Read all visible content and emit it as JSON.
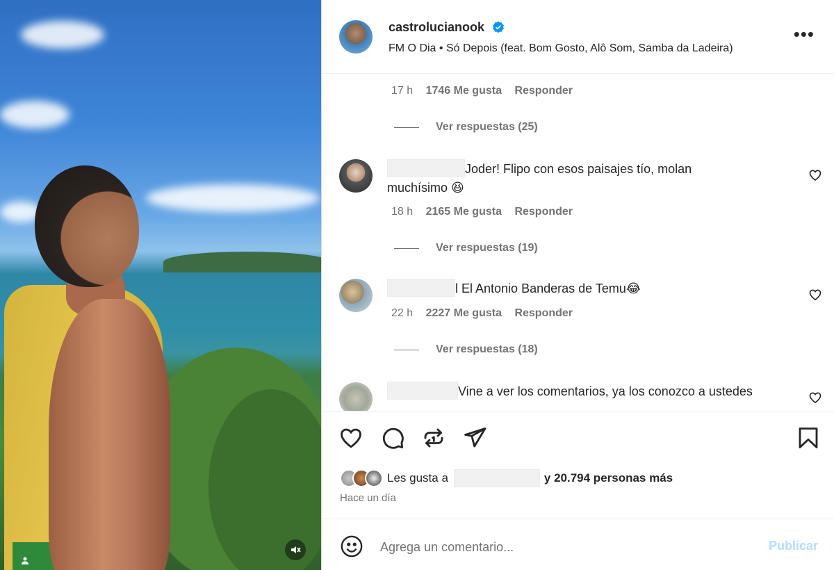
{
  "post": {
    "username": "castrolucianook",
    "audio": "FM O Dia • Só Depois (feat. Bom Gosto, Alô Som, Samba da Ladeira)",
    "more_icon": "more-horizontal-icon"
  },
  "comments": [
    {
      "time": "17 h",
      "likes": "1746 Me gusta",
      "reply": "Responder",
      "view_replies": "Ver respuestas (25)"
    },
    {
      "text": "Joder! Flipo con esos paisajes tío, molan muchísimo 😆",
      "time": "18 h",
      "likes": "2165 Me gusta",
      "reply": "Responder",
      "view_replies": "Ver respuestas (19)"
    },
    {
      "text": "l El Antonio Banderas de Temu😂",
      "time": "22 h",
      "likes": "2227 Me gusta",
      "reply": "Responder",
      "view_replies": "Ver respuestas (18)"
    },
    {
      "text": "Vine a ver los comentarios, ya los conozco a ustedes"
    }
  ],
  "actions": {
    "icons": [
      "heart-icon",
      "comment-icon",
      "repost-icon",
      "share-icon",
      "bookmark-icon"
    ]
  },
  "likes": {
    "prefix": "Les gusta a",
    "suffix": "y 20.794 personas más"
  },
  "time_ago": "Hace un día",
  "composer": {
    "placeholder": "Agrega un comentario...",
    "publish_label": "Publicar"
  },
  "colors": {
    "link_disabled": "#b2dffc",
    "secondary_text": "#737373",
    "verified": "#0095f6"
  }
}
